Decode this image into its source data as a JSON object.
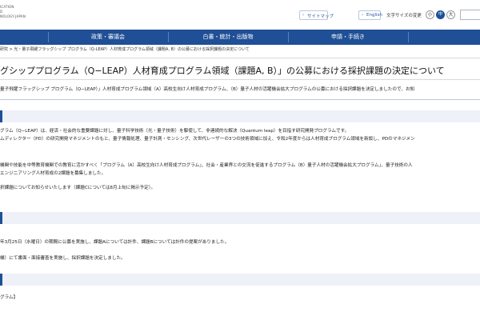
{
  "header": {
    "logo_lines": [
      "ICATION",
      "D",
      "NOLOGY-JAPAN"
    ],
    "sitemap_label": "サイトマップ",
    "english_label": "English",
    "fontsize_label": "文字サイズの変更",
    "fontsize_small": "小",
    "fontsize_mid": "中",
    "fontsize_large": "大",
    "colors": {
      "nav_bg": "#1f4f96",
      "accent": "#2b5aa0",
      "band": "#eef1f8"
    }
  },
  "nav": {
    "items": [
      "政策・審議会",
      "白書・統計・出版物",
      "申請・手続き"
    ]
  },
  "breadcrumb": "研究 > 光・量子飛躍フラッグシップ プログラム（Q-LEAP）人材育成プログラム領域（課題A, B）の公募における採択課題の決定について",
  "page_title": "グシッププログラム（Q−LEAP）人材育成プログラム領域（課題A, B）」の公募における採択課題の決定について",
  "intro": "量子飛躍フラッグシップ プログラム（Q−LEAP）」人材育成プログラム領域（A）高校生向け人材育成プログラム、（B）量子人材の活躍機会拡大プログラムの公募における採択課題を決定しましたので、お知",
  "overview": {
    "line1": "グラム（Q−LEAP）は、経済・社会的な重要課題に対し、量子科学技術（光・量子技術）を駆使して、非連続的な解決（Quantum leap）を目指す研究開発プログラムです。",
    "line2": "ムディレクター（PD）の研究開発マネジメントのもと、量子情報処理、量子計測・センシング、次世代レーザーの3つの技術領域に加え、令和2年度からは人材育成プログラム領域を新設し、PDのマネジメン",
    "line3": "機関や技能を中等教育機関での教育に活かすべく「プログラム（A）高校生向け人材育成プログラム」、社会・産業界との交流を促進するプログラム（B）量子人材の活躍機会拡大プログラム」、量子技術の人",
    "line4": "エンジニアリング人材育成の2課題を募集しました。",
    "line5": "択課題についてお知らせいたします（課題Cについては8月上旬に掲示予定）。"
  },
  "schedule": {
    "line1": "年3月25日（水曜日）の期間に公募を実施し、課題Aについては計件、課題Bについては計件の提案がありました。",
    "line2": "機）にて書面・面接審査を実施し、採択課題を決定しました。"
  },
  "footer_text": "グラム】"
}
